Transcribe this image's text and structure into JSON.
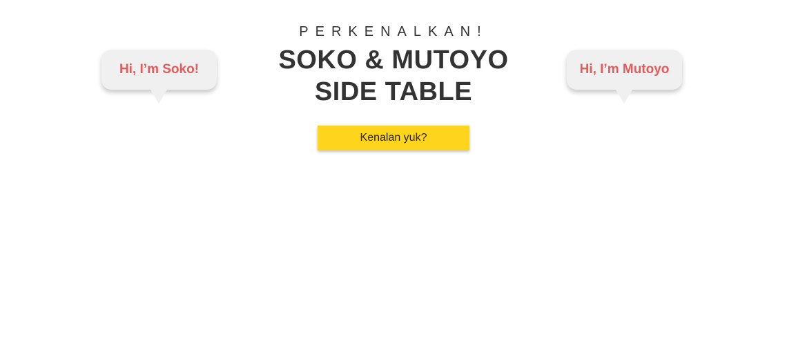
{
  "hero": {
    "eyebrow": "PERKENALKAN!",
    "title_line1": "SOKO & MUTOYO",
    "title_line2": "SIDE TABLE",
    "cta_label": "Kenalan yuk?"
  },
  "bubbles": {
    "soko": "Hi, I’m Soko!",
    "mutoyo": "Hi, I’m Mutoyo"
  },
  "colors": {
    "cta_background": "#ffd41d",
    "bubble_text": "#e25c5c",
    "bubble_background": "#f0f0f0",
    "heading_text": "#333333"
  }
}
